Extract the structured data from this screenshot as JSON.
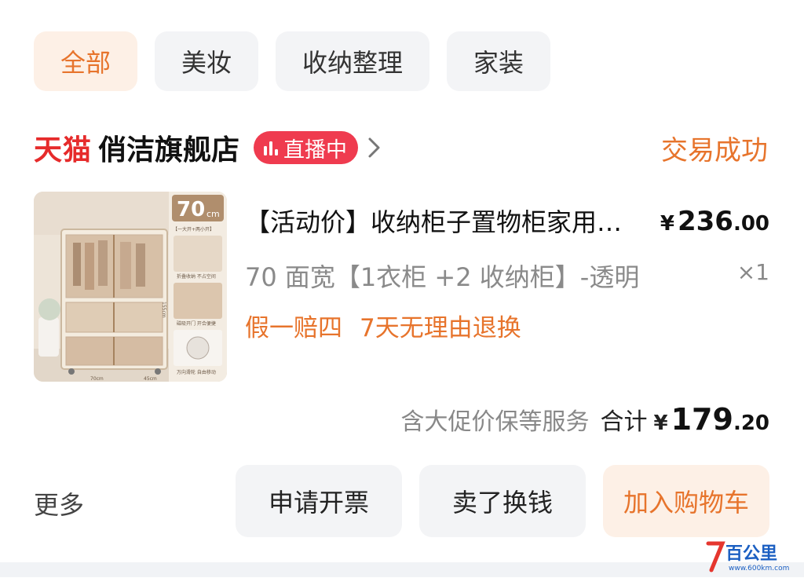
{
  "tabs": [
    {
      "label": "全部",
      "active": true
    },
    {
      "label": "美妆",
      "active": false
    },
    {
      "label": "收纳整理",
      "active": false
    },
    {
      "label": "家装",
      "active": false
    }
  ],
  "order": {
    "platform_logo": "天猫",
    "store_name": "俏洁旗舰店",
    "live_badge": "直播中",
    "status": "交易成功",
    "product": {
      "title": "【活动价】收纳柜子置物柜家用…",
      "price_symbol": "¥",
      "price_int": "236",
      "price_dec": ".00",
      "spec": "70 面宽【1衣柜 +2 收纳柜】-透明",
      "quantity": "×1",
      "tags": [
        "假一赔四",
        "7天无理由退换"
      ],
      "image": {
        "size_label": "70",
        "size_unit": "cm",
        "top_note": "【一大开+两小开】",
        "captions": [
          "折叠收纳 不占空间",
          "磁吸开门 开合便捷",
          "万向滑轮 自由移动"
        ],
        "dims": [
          "70cm",
          "45cm",
          "155cm"
        ]
      }
    },
    "total": {
      "note": "含大促价保等服务",
      "label": "合计",
      "symbol": "¥",
      "int": "179",
      "dec": ".20"
    }
  },
  "footer": {
    "more": "更多",
    "buttons": [
      "申请开票",
      "卖了换钱",
      "加入购物车"
    ]
  },
  "watermark": "百公里 www.600km.com",
  "colors": {
    "accent": "#e7742c",
    "accent_bg": "#fdf0e6",
    "tmall_red": "#e62b2b",
    "live_red": "#ef3b4f",
    "chip_bg": "#f3f4f6"
  }
}
